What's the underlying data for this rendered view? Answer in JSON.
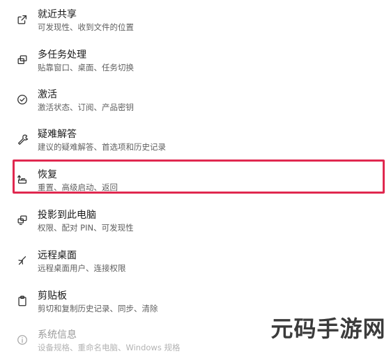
{
  "items": [
    {
      "title": "就近共享",
      "subtitle": "可发现性、收到文件的位置",
      "icon": "share-icon"
    },
    {
      "title": "多任务处理",
      "subtitle": "贴靠窗口、桌面、任务切换",
      "icon": "multitask-icon"
    },
    {
      "title": "激活",
      "subtitle": "激活状态、订阅、产品密钥",
      "icon": "activation-check-icon"
    },
    {
      "title": "疑难解答",
      "subtitle": "建议的疑难解答、首选项和历史记录",
      "icon": "wrench-icon"
    },
    {
      "title": "恢复",
      "subtitle": "重置、高级启动、返回",
      "icon": "recovery-icon"
    },
    {
      "title": "投影到此电脑",
      "subtitle": "权限、配对 PIN、可发现性",
      "icon": "project-icon"
    },
    {
      "title": "远程桌面",
      "subtitle": "远程桌面用户、连接权限",
      "icon": "remote-desktop-icon"
    },
    {
      "title": "剪贴板",
      "subtitle": "剪切和复制历史记录、同步、清除",
      "icon": "clipboard-icon"
    },
    {
      "title": "系统信息",
      "subtitle": "设备规格、重命名电脑、Windows 规格",
      "icon": "info-icon"
    }
  ],
  "highlight_color": "#e0284f",
  "watermark": "元码手游网"
}
